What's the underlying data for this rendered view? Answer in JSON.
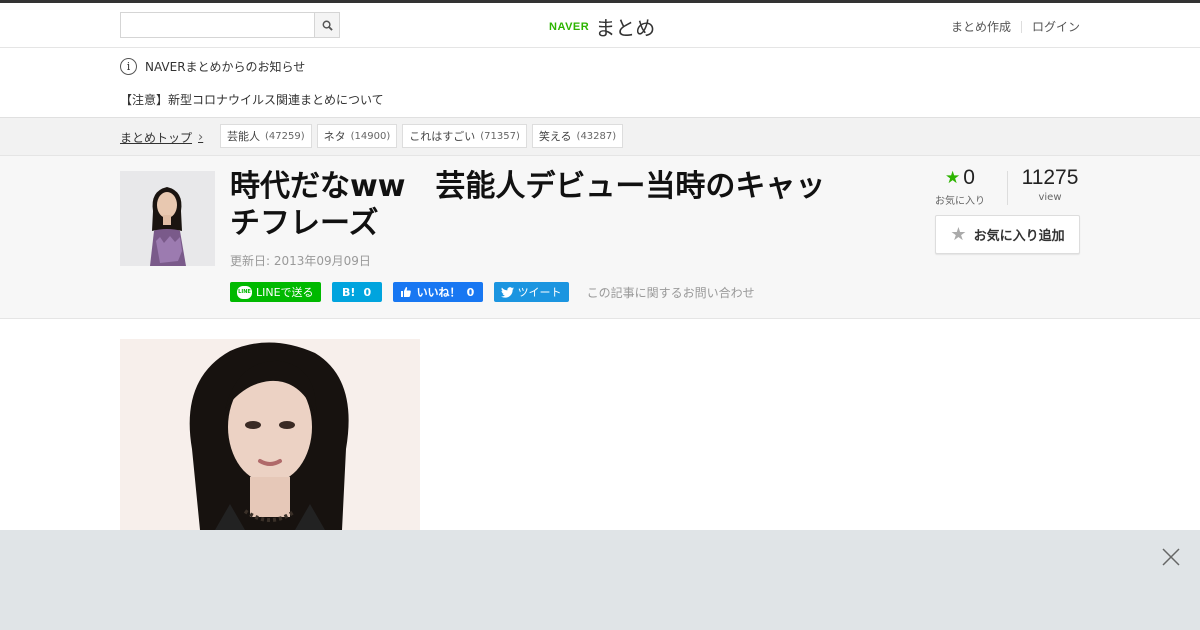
{
  "header": {
    "search": {
      "value": "",
      "placeholder": ""
    },
    "logo": {
      "brand": "NAVER",
      "service": "まとめ"
    },
    "nav": {
      "create": "まとめ作成",
      "login": "ログイン"
    }
  },
  "notice": {
    "heading": "NAVERまとめからのお知らせ",
    "item": "【注意】新型コロナウイルス関連まとめについて"
  },
  "breadcrumb": {
    "top": "まとめトップ",
    "tags": [
      {
        "label": "芸能人",
        "count": "(47259)"
      },
      {
        "label": "ネタ",
        "count": "(14900)"
      },
      {
        "label": "これはすごい",
        "count": "(71357)"
      },
      {
        "label": "笑える",
        "count": "(43287)"
      }
    ]
  },
  "article": {
    "title": "時代だなww　芸能人デビュー当時のキャッチフレーズ",
    "updated": "更新日: 2013年09月09日",
    "share": {
      "line": "LINEで送る",
      "hatena_mark": "B!",
      "hatena_count": "0",
      "like_label": "いいね！",
      "like_count": "0",
      "tweet": "ツイート",
      "inquiry": "この記事に関するお問い合わせ"
    },
    "stats": {
      "favorites": "0",
      "favorites_label": "お気に入り",
      "views": "11275",
      "views_label": "view"
    },
    "fav_button": "お気に入り追加"
  },
  "colors": {
    "naver_green": "#2db400",
    "line_green": "#00b900",
    "hatena_blue": "#00a4de",
    "facebook_blue": "#1877f2",
    "twitter_blue": "#1b95e0",
    "ad_bar": "#e0e4e7"
  },
  "icons": [
    "search-icon",
    "info-icon",
    "chevron-right-icon",
    "line-icon",
    "facebook-like-icon",
    "twitter-bird-icon",
    "star-icon",
    "close-icon"
  ]
}
